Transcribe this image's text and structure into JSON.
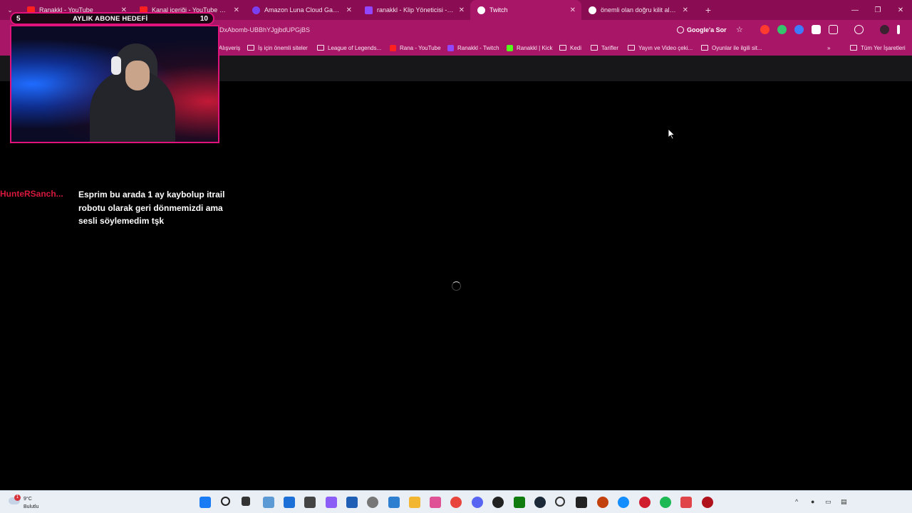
{
  "browser": {
    "tabs": [
      {
        "title": "Ranakkl - YouTube",
        "favicon_color": "#ff2020",
        "active": false
      },
      {
        "title": "Kanal içeriği - YouTube Studio",
        "favicon_color": "#ff2020",
        "active": false
      },
      {
        "title": "Amazon Luna Cloud Gaming",
        "favicon_color": "#7b3ff2",
        "active": false
      },
      {
        "title": "ranakkl - Klip Yöneticisi - Twitch",
        "favicon_color": "#9146ff",
        "active": false
      },
      {
        "title": "Twitch",
        "favicon_color": "#ffffff",
        "active": true
      },
      {
        "title": "önemli olan doğru kilit alma - G",
        "favicon_color": "#ffffff",
        "active": false
      }
    ],
    "url_fragment": "DxAbomb-UBBhYJgjbdUPGjBS",
    "lens_label": "Google'a Sor",
    "bookmarks": [
      {
        "label": "Alışveriş",
        "type": "folder"
      },
      {
        "label": "İş için önemli siteler",
        "type": "folder"
      },
      {
        "label": "League of Legends...",
        "type": "folder"
      },
      {
        "label": "Rana - YouTube",
        "type": "youtube"
      },
      {
        "label": "Ranakkl - Twitch",
        "type": "twitch"
      },
      {
        "label": "Ranakkl | Kick",
        "type": "kick"
      },
      {
        "label": "Kedi",
        "type": "folder"
      },
      {
        "label": "Tarifler",
        "type": "folder"
      },
      {
        "label": "Yayın ve Video çeki...",
        "type": "folder"
      },
      {
        "label": "Oyunlar ile ilgili sit...",
        "type": "folder"
      },
      {
        "label": "Tüm Yer İşaretleri",
        "type": "folder"
      }
    ]
  },
  "overlay": {
    "goal": {
      "current": "5",
      "title": "AYLIK ABONE HEDEFİ",
      "target": "10"
    },
    "chat": {
      "username": "HunteRSanch...",
      "message": "Esprim bu arada 1 ay kaybolup itrail robotu olarak geri dönmemizdi ama sesli söylemedim tşk"
    }
  },
  "taskbar": {
    "weather": {
      "temp": "9°C",
      "condition": "Bulutlu",
      "badge": "1"
    },
    "icons": [
      "windows-start-icon",
      "search-icon",
      "file-explorer-icon",
      "photos-icon",
      "edge-icon",
      "app-icon",
      "copilot-icon",
      "store-icon",
      "settings-icon",
      "photos-app-icon",
      "folder-icon",
      "media-icon",
      "chrome-icon",
      "discord-icon",
      "obs-icon",
      "xbox-icon",
      "steam-icon",
      "app-circle-icon",
      "epic-games-icon",
      "game-icon",
      "battle-net-icon",
      "app-red-icon",
      "spotify-icon",
      "game-controller-icon",
      "red-circle-icon"
    ]
  }
}
